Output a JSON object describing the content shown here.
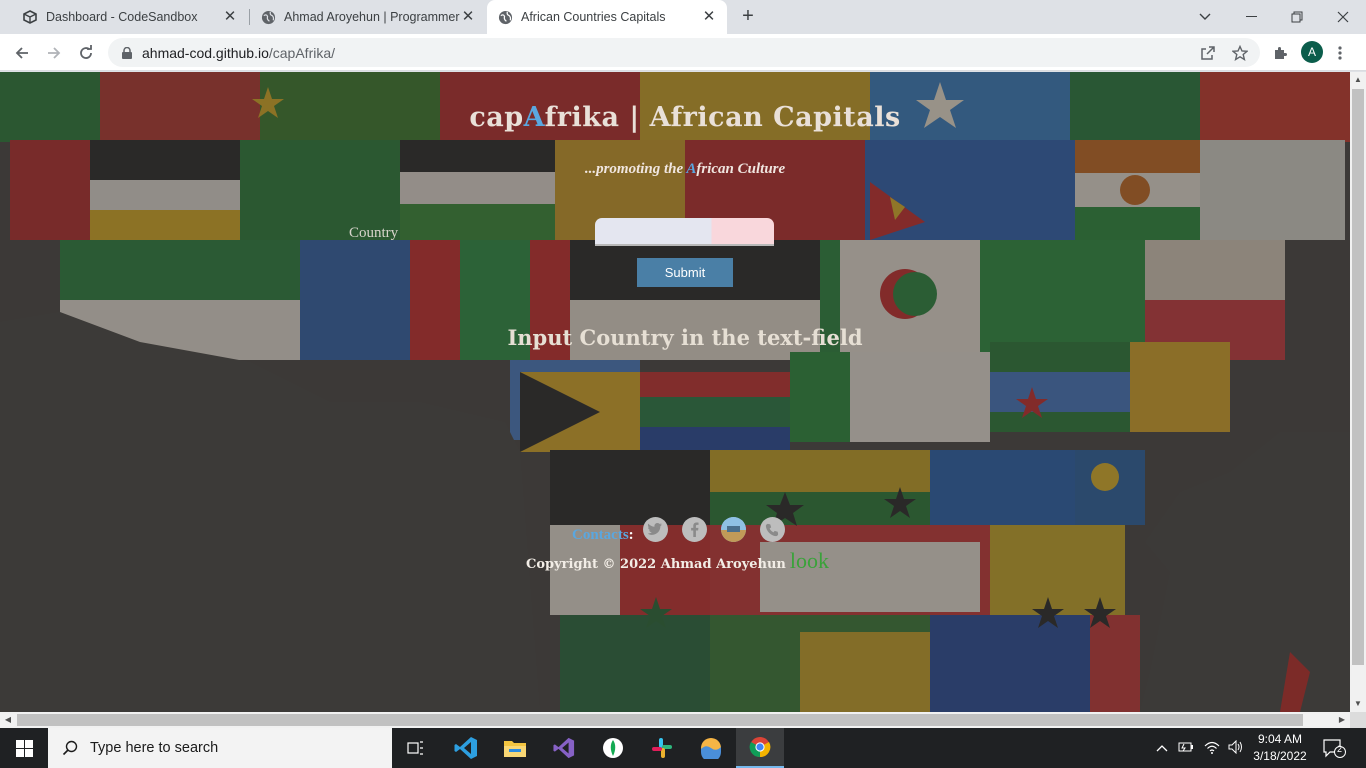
{
  "browser": {
    "tabs": [
      {
        "title": "Dashboard - CodeSandbox",
        "favicon": "codesandbox-icon",
        "active": false
      },
      {
        "title": "Ahmad Aroyehun | Programmer",
        "favicon": "globe-icon",
        "active": false
      },
      {
        "title": "African Countries Capitals",
        "favicon": "globe-icon",
        "active": true
      }
    ],
    "url_host": "ahmad-cod.github.io",
    "url_path": "/capAfrika/",
    "profile_initial": "A"
  },
  "page": {
    "title_part1": "cap",
    "title_accent": "A",
    "title_part2": "frika | African Capitals",
    "tagline_part1": "...promoting the ",
    "tagline_accent": "A",
    "tagline_part2": "frican Culture",
    "country_label": "Country",
    "country_input_value": "",
    "submit_label": "Submit",
    "result_message": "Input Country in the text-field",
    "contacts_label": "Contacts",
    "contacts_colon": ":",
    "social_icons": [
      "twitter-icon",
      "facebook-icon",
      "portfolio-icon",
      "phone-icon"
    ],
    "copyright": "Copyright © 2022 Ahmad Aroyehun",
    "copyright_link": "look",
    "accent_color": "#5aa7e0"
  },
  "taskbar": {
    "search_placeholder": "Type here to search",
    "apps": [
      "task-view-icon",
      "vscode-icon",
      "file-explorer-icon",
      "visual-studio-icon",
      "mongodb-compass-icon",
      "slack-icon",
      "app-icon",
      "chrome-icon"
    ],
    "time": "9:04 AM",
    "date": "3/18/2022",
    "notification_count": "2"
  }
}
